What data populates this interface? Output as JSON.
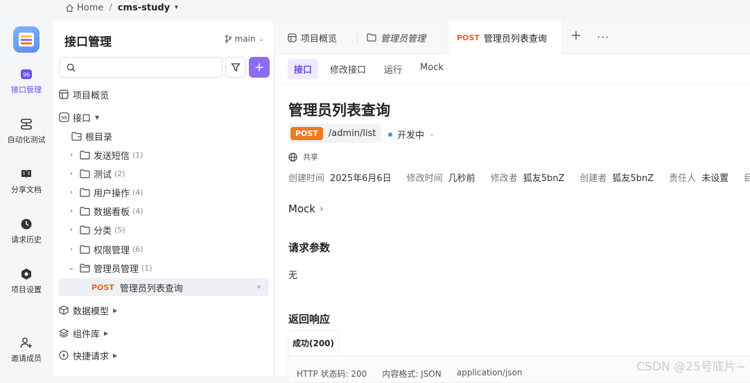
{
  "breadcrumb": {
    "home": "Home",
    "sep": "/",
    "project": "cms-study"
  },
  "rail": {
    "items": [
      {
        "label": "接口管理",
        "icon": "api-icon"
      },
      {
        "label": "自动化测试",
        "icon": "automation-icon"
      },
      {
        "label": "分享文档",
        "icon": "book-icon"
      },
      {
        "label": "请求历史",
        "icon": "clock-icon"
      },
      {
        "label": "项目设置",
        "icon": "settings-icon"
      },
      {
        "label": "邀请成员",
        "icon": "add-user-icon"
      }
    ]
  },
  "sidebar": {
    "title": "接口管理",
    "branch": "main",
    "search_placeholder": "",
    "overview": "项目概览",
    "api_root": "接口",
    "root_dir": "根目录",
    "folders": [
      {
        "name": "发送短信",
        "count": "(1)"
      },
      {
        "name": "测试",
        "count": "(2)"
      },
      {
        "name": "用户操作",
        "count": "(4)"
      },
      {
        "name": "数据看板",
        "count": "(4)"
      },
      {
        "name": "分类",
        "count": "(5)"
      },
      {
        "name": "权限管理",
        "count": "(6)"
      },
      {
        "name": "管理员管理",
        "count": "(1)"
      }
    ],
    "selected_item": {
      "method": "POST",
      "name": "管理员列表查询"
    },
    "data_model": "数据模型",
    "components": "组件库",
    "quick_request": "快捷请求"
  },
  "tabs": [
    {
      "label": "项目概览"
    },
    {
      "label": "管理员管理"
    },
    {
      "method": "POST",
      "label": "管理员列表查询"
    }
  ],
  "tab_more": "···",
  "subtabs": [
    "接口",
    "修改接口",
    "运行",
    "Mock"
  ],
  "api": {
    "title": "管理员列表查询",
    "method": "POST",
    "path": "/admin/list",
    "status": "开发中",
    "share": "共享",
    "meta": [
      {
        "k": "创建时间",
        "v": "2025年6月6日"
      },
      {
        "k": "修改时间",
        "v": "几秒前"
      },
      {
        "k": "修改者",
        "v": "狐友5bnZ"
      },
      {
        "k": "创建者",
        "v": "狐友5bnZ"
      },
      {
        "k": "责任人",
        "v": "未设置"
      },
      {
        "k": "目录",
        "v": ""
      }
    ]
  },
  "sections": {
    "mock": "Mock",
    "params": "请求参数",
    "params_value": "无",
    "response": "返回响应",
    "response_tab": "成功(200)",
    "http_status": "HTTP 状态码: 200",
    "content_type": "内容格式: JSON",
    "mime": "application/json"
  },
  "watermark": "CSDN @25号底片~",
  "colors": {
    "accent": "#8b6cf2",
    "post": "#f07a1e",
    "status_dot": "#3f8cff"
  }
}
